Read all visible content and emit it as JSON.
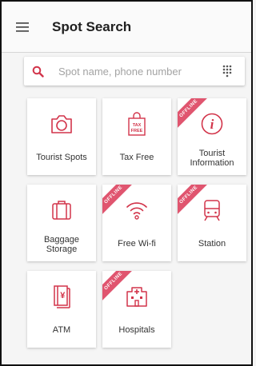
{
  "header": {
    "title": "Spot Search"
  },
  "search": {
    "placeholder": "Spot name, phone number"
  },
  "theme": {
    "accent": "#d2344a",
    "ribbon": "#e0556f"
  },
  "tiles": [
    {
      "label": "Tourist Spots",
      "icon": "camera-icon",
      "offline": false
    },
    {
      "label": "Tax Free",
      "icon": "tax-free-bag-icon",
      "offline": false,
      "icon_text": "TAX\nFREE"
    },
    {
      "label": "Tourist\nInformation",
      "icon": "info-icon",
      "offline": true,
      "ribbon": "OFFLINE"
    },
    {
      "label": "Baggage\nStorage",
      "icon": "luggage-icon",
      "offline": false
    },
    {
      "label": "Free Wi-fi",
      "icon": "wifi-icon",
      "offline": true,
      "ribbon": "OFFLINE"
    },
    {
      "label": "Station",
      "icon": "train-icon",
      "offline": true,
      "ribbon": "OFFLINE"
    },
    {
      "label": "ATM",
      "icon": "atm-icon",
      "offline": false,
      "icon_text": "¥"
    },
    {
      "label": "Hospitals",
      "icon": "hospital-icon",
      "offline": true,
      "ribbon": "OFFLINE"
    }
  ]
}
